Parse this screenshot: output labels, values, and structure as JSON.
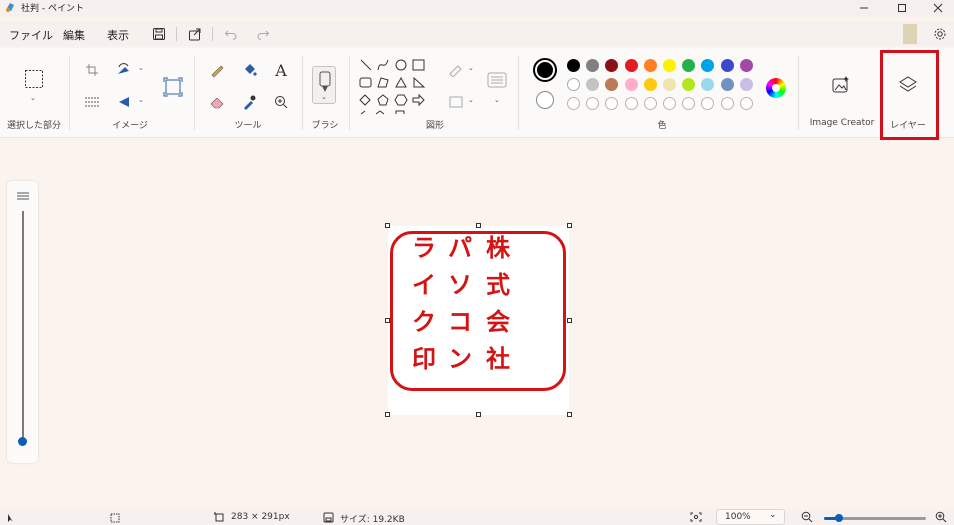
{
  "window": {
    "title": "社判 - ペイント",
    "minimize_icon": "minimize-icon",
    "maximize_icon": "maximize-icon",
    "close_icon": "close-icon"
  },
  "menu": {
    "items": [
      {
        "label": "ファイル"
      },
      {
        "label": "編集"
      },
      {
        "label": "表示"
      }
    ],
    "quick_icons": [
      "save-icon",
      "share-icon",
      "undo-icon",
      "redo-icon"
    ],
    "settings_icon": "gear-icon"
  },
  "ribbon": {
    "groups": {
      "selection": "選択した部分",
      "image": "イメージ",
      "tools": "ツール",
      "brush": "ブラシ",
      "shapes": "図形",
      "colors": "色",
      "image_creator": "Image Creator",
      "layers": "レイヤー"
    },
    "colors": {
      "primary": "#000000",
      "secondary": "#ffffff",
      "row1": [
        "#000000",
        "#808080",
        "#8b1116",
        "#e21b23",
        "#ff7f27",
        "#fff200",
        "#22b14c",
        "#00a2e8",
        "#3f48cc",
        "#a349a4"
      ],
      "row2": [
        "#ffffff",
        "#c3c3c3",
        "#b97a57",
        "#ffaec9",
        "#ffc90e",
        "#efe4b0",
        "#b5e61d",
        "#99d9ea",
        "#7092be",
        "#c8bfe7"
      ],
      "empty_count": 10
    }
  },
  "canvas": {
    "stamp_color": "#d41414",
    "columns": [
      [
        "ラ",
        "イ",
        "ク",
        "印"
      ],
      [
        "パ",
        "ソ",
        "コ",
        "ン"
      ],
      [
        "株",
        "式",
        "会",
        "社"
      ]
    ]
  },
  "statusbar": {
    "dimensions": "283 × 291px",
    "file_size": "サイズ: 19.2KB",
    "zoom": "100%",
    "zoom_level": 0.15
  }
}
